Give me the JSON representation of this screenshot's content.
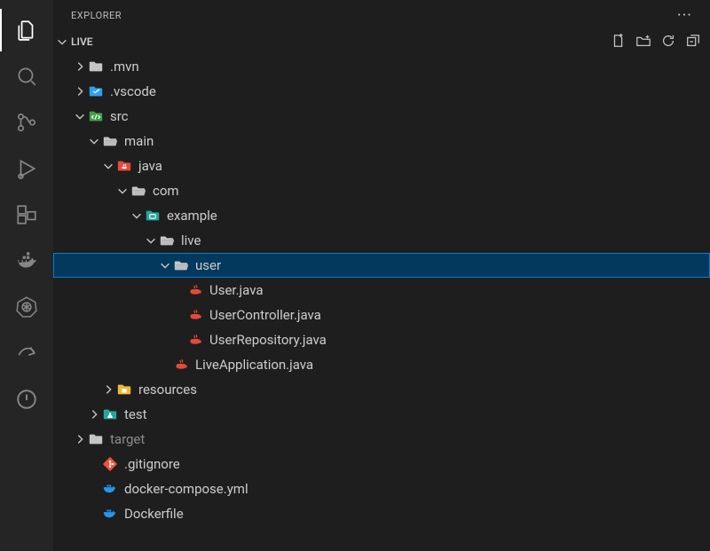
{
  "explorer": {
    "title": "EXPLORER",
    "project": "LIVE"
  },
  "colors": {
    "folder": "#c5c5c5",
    "vscode": "#2ea0f0",
    "srcGreen": "#43a047",
    "javaRed": "#e64a3b",
    "exampleTeal": "#26a69a",
    "resourcesYellow": "#f0b83a",
    "testTeal": "#26a69a",
    "gitOrange": "#f05033",
    "dockerBlue": "#2496ed"
  },
  "tree": [
    {
      "depth": 0,
      "chev": "right",
      "icon": "folder",
      "color": "folder",
      "label": ".mvn"
    },
    {
      "depth": 0,
      "chev": "right",
      "icon": "vscode",
      "color": "vscode",
      "label": ".vscode"
    },
    {
      "depth": 0,
      "chev": "down",
      "icon": "srcfolder",
      "color": "srcGreen",
      "label": "src"
    },
    {
      "depth": 1,
      "chev": "down",
      "icon": "folder-open",
      "color": "folder",
      "label": "main"
    },
    {
      "depth": 2,
      "chev": "down",
      "icon": "javafolder",
      "color": "javaRed",
      "label": "java"
    },
    {
      "depth": 3,
      "chev": "down",
      "icon": "folder-open",
      "color": "folder",
      "label": "com"
    },
    {
      "depth": 4,
      "chev": "down",
      "icon": "exfolder",
      "color": "exampleTeal",
      "label": "example"
    },
    {
      "depth": 5,
      "chev": "down",
      "icon": "folder-open",
      "color": "folder",
      "label": "live"
    },
    {
      "depth": 6,
      "chev": "down",
      "icon": "folder-open",
      "color": "folder",
      "label": "user",
      "selected": true
    },
    {
      "depth": 7,
      "chev": "none",
      "icon": "java",
      "color": "javaRed",
      "label": "User.java"
    },
    {
      "depth": 7,
      "chev": "none",
      "icon": "java",
      "color": "javaRed",
      "label": "UserController.java"
    },
    {
      "depth": 7,
      "chev": "none",
      "icon": "java",
      "color": "javaRed",
      "label": "UserRepository.java"
    },
    {
      "depth": 6,
      "chev": "none",
      "icon": "java",
      "color": "javaRed",
      "label": "LiveApplication.java"
    },
    {
      "depth": 2,
      "chev": "right",
      "icon": "resfolder",
      "color": "resourcesYellow",
      "label": "resources"
    },
    {
      "depth": 1,
      "chev": "right",
      "icon": "testfolder",
      "color": "testTeal",
      "label": "test"
    },
    {
      "depth": 0,
      "chev": "right",
      "icon": "folder",
      "color": "folder",
      "label": "target",
      "muted": true
    },
    {
      "depth": 1,
      "chev": "none",
      "icon": "git",
      "color": "gitOrange",
      "label": ".gitignore"
    },
    {
      "depth": 1,
      "chev": "none",
      "icon": "docker",
      "color": "dockerBlue",
      "label": "docker-compose.yml"
    },
    {
      "depth": 1,
      "chev": "none",
      "icon": "docker",
      "color": "dockerBlue",
      "label": "Dockerfile"
    }
  ]
}
